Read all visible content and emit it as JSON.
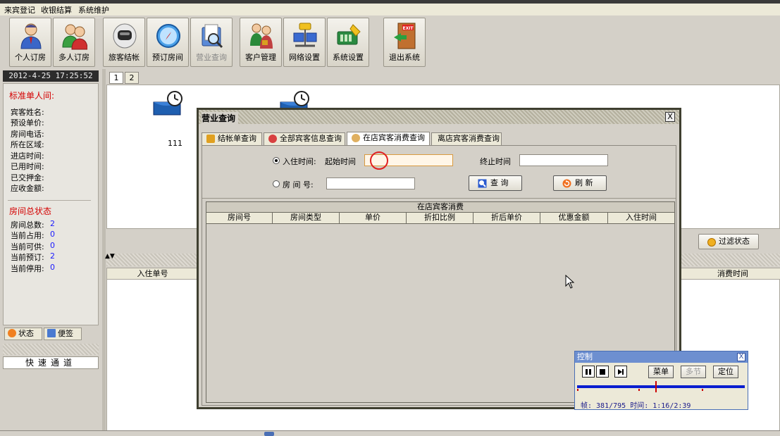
{
  "menu": [
    "来宾登记",
    "收银结算",
    "系统维护"
  ],
  "toolbar": {
    "buttons": [
      {
        "label": "个人订房",
        "icon": "single-user-icon"
      },
      {
        "label": "多人订房",
        "icon": "multi-user-icon"
      },
      {
        "label": "旅客结帐",
        "icon": "astronaut-icon"
      },
      {
        "label": "预订房间",
        "icon": "compass-icon"
      },
      {
        "label": "营业查询",
        "icon": "search-folder-icon",
        "disabled": true
      },
      {
        "label": "客户管理",
        "icon": "customers-icon"
      },
      {
        "label": "网络设置",
        "icon": "network-icon"
      },
      {
        "label": "系统设置",
        "icon": "settings-icon"
      },
      {
        "label": "退出系统",
        "icon": "exit-door-icon"
      }
    ],
    "exit_sign": "EXIT"
  },
  "left_panel": {
    "datetime": "2012-4-25 17:25:52",
    "room_section_title": "标准单人间:",
    "room_fields": [
      "宾客姓名:",
      "预设单价:",
      "房间电话:",
      "所在区域:",
      "进店时间:",
      "已用时间:",
      "已交押金:",
      "应收金额:"
    ],
    "status_section_title": "房间总状态",
    "status_rows": [
      {
        "label": "房间总数:",
        "value": "2"
      },
      {
        "label": "当前占用:",
        "value": "0"
      },
      {
        "label": "当前可供:",
        "value": "0"
      },
      {
        "label": "当前预订:",
        "value": "2"
      },
      {
        "label": "当前停用:",
        "value": "0"
      }
    ],
    "tabs": [
      "状态",
      "便签"
    ],
    "quick_channel": "快速通道"
  },
  "main": {
    "room_tabs": [
      "1",
      "2"
    ],
    "rooms": [
      {
        "number": "111"
      }
    ],
    "filter_button": "过滤状态",
    "arrows": "▲▼",
    "grid_headers": [
      "入住单号",
      "消费时间"
    ]
  },
  "dialog": {
    "title": "营业查询",
    "close": "X",
    "tabs": [
      "结帐单查询",
      "全部宾客信息查询",
      "在店宾客消费查询",
      "离店宾客消费查询"
    ],
    "active_tab": 2,
    "checkin_label": "入住时间:",
    "start_label": "起始时间",
    "end_label": "终止时间",
    "start_value": "",
    "end_value": "",
    "room_label": "房 间 号:",
    "room_value": "",
    "query_button": "查 询",
    "refresh_button": "刷 新",
    "table_caption": "在店宾客消费",
    "table_headers": [
      "房间号",
      "房间类型",
      "单价",
      "折扣比例",
      "折后单价",
      "优惠金额",
      "入住时间"
    ]
  },
  "control": {
    "title": "控制",
    "close": "X",
    "menu_button": "菜单",
    "multi_button": "多节",
    "locate_button": "定位",
    "status": "帧: 381/795 时间: 1:16/2:39"
  }
}
